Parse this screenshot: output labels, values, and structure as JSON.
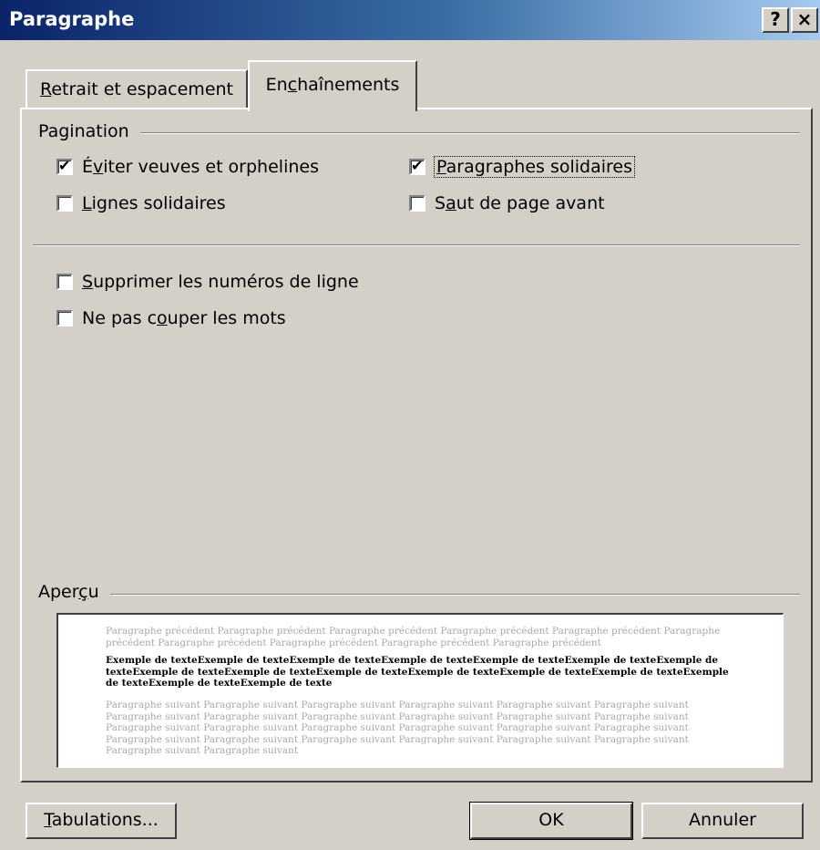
{
  "window": {
    "title": "Paragraphe",
    "help_button": "?",
    "close_button": "×"
  },
  "tabs": {
    "retrait": {
      "pre": "",
      "mnemonic": "R",
      "post": "etrait et espacement"
    },
    "enchainements": {
      "pre": "En",
      "mnemonic": "c",
      "post": "haînements"
    }
  },
  "pagination": {
    "label": "Pagination",
    "widow": {
      "pre": "É",
      "mnemonic": "v",
      "post": "iter veuves et orphelines",
      "checked": true
    },
    "keep_next": {
      "pre": "",
      "mnemonic": "P",
      "post": "aragraphes solidaires",
      "checked": true
    },
    "keep_lines": {
      "pre": "",
      "mnemonic": "L",
      "post": "ignes solidaires",
      "checked": false
    },
    "page_break": {
      "pre": "S",
      "mnemonic": "a",
      "post": "ut de page avant",
      "checked": false
    }
  },
  "other": {
    "suppress": {
      "pre": "",
      "mnemonic": "S",
      "post": "upprimer les numéros de ligne",
      "checked": false
    },
    "no_hyphen": {
      "pre": "Ne pas c",
      "mnemonic": "o",
      "post": "uper les mots",
      "checked": false
    }
  },
  "apercu": {
    "label_pre": "Aper",
    "label_mnemonic": "ç",
    "label_post": "u",
    "previous_text": "Paragraphe précédent Paragraphe précédent Paragraphe précédent Paragraphe précédent Paragraphe précédent Paragraphe précédent Paragraphe précédent Paragraphe précédent Paragraphe précédent Paragraphe précédent",
    "current_text": "Exemple de texteExemple de texteExemple de texteExemple de texteExemple de texteExemple de texteExemple de texteExemple de texteExemple de texteExemple de texteExemple de texteExemple de texteExemple de texteExemple de texteExemple de texteExemple de texte",
    "next_text": "Paragraphe suivant Paragraphe suivant Paragraphe suivant Paragraphe suivant Paragraphe suivant Paragraphe suivant Paragraphe suivant Paragraphe suivant Paragraphe suivant Paragraphe suivant Paragraphe suivant Paragraphe suivant Paragraphe suivant Paragraphe suivant Paragraphe suivant Paragraphe suivant Paragraphe suivant Paragraphe suivant Paragraphe suivant Paragraphe suivant Paragraphe suivant Paragraphe suivant Paragraphe suivant Paragraphe suivant Paragraphe suivant Paragraphe suivant"
  },
  "buttons": {
    "tabulations": {
      "pre": "",
      "mnemonic": "T",
      "post": "abulations..."
    },
    "ok": "OK",
    "cancel": "Annuler"
  }
}
